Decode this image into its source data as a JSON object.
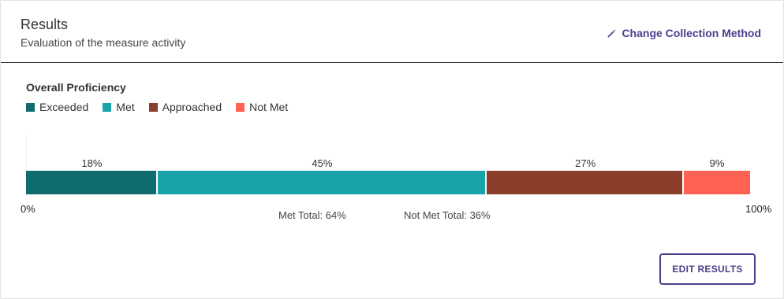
{
  "header": {
    "title": "Results",
    "subtitle": "Evaluation of the measure activity",
    "change_method_label": "Change Collection Method",
    "change_method_icon": "pencil-icon"
  },
  "proficiency": {
    "title": "Overall Proficiency",
    "legend": [
      {
        "label": "Exceeded",
        "color": "#0f6b70"
      },
      {
        "label": "Met",
        "color": "#18a3a8"
      },
      {
        "label": "Approached",
        "color": "#8b3f2a"
      },
      {
        "label": "Not Met",
        "color": "#ff6153"
      }
    ]
  },
  "chart_data": {
    "type": "bar",
    "orientation": "horizontal-stacked",
    "categories": [
      "Exceeded",
      "Met",
      "Approached",
      "Not Met"
    ],
    "values": [
      18,
      45,
      27,
      9
    ],
    "value_labels": [
      "18%",
      "45%",
      "27%",
      "9%"
    ],
    "colors": [
      "#0f6b70",
      "#18a3a8",
      "#8b3f2a",
      "#ff6153"
    ],
    "xlim": [
      0,
      100
    ],
    "axis_min_label": "0%",
    "axis_max_label": "100%",
    "met_total_label": "Met Total: 64%",
    "not_met_total_label": "Not Met Total: 36%"
  },
  "actions": {
    "edit_results_label": "EDIT RESULTS"
  }
}
